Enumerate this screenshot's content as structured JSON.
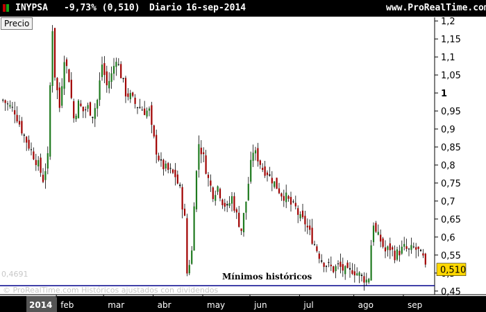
{
  "header": {
    "ticker": "INYPSA",
    "change": "-9,73% (0,510)",
    "period": "Diario",
    "date": "16-sep-2014",
    "site": "www.ProRealTime.com"
  },
  "colors": {
    "up": "#1f7a1f",
    "down": "#a00000",
    "neutral": "#000000",
    "support": "#00008b",
    "price_tag": "#ffd700",
    "year_bar": "#000000"
  },
  "chart_data": {
    "type": "candlestick",
    "legend_label": "Precio",
    "last_price_label": "0,510",
    "support_level": 0.465,
    "support_label_ghost": "0,4691",
    "annotation": "Mínimos históricos",
    "watermark": "© ProRealTime.com  Históricos ajustados con dividendos",
    "ylim": [
      0.44,
      1.21
    ],
    "y_ticks": [
      {
        "v": 1.2,
        "label": "1,2"
      },
      {
        "v": 1.15,
        "label": "1,15"
      },
      {
        "v": 1.1,
        "label": "1,1"
      },
      {
        "v": 1.05,
        "label": "1,05"
      },
      {
        "v": 1.0,
        "label": "1"
      },
      {
        "v": 0.95,
        "label": "0,95"
      },
      {
        "v": 0.9,
        "label": "0,9"
      },
      {
        "v": 0.85,
        "label": "0,85"
      },
      {
        "v": 0.8,
        "label": "0,8"
      },
      {
        "v": 0.75,
        "label": "0,75"
      },
      {
        "v": 0.7,
        "label": "0,7"
      },
      {
        "v": 0.65,
        "label": "0,65"
      },
      {
        "v": 0.6,
        "label": "0,6"
      },
      {
        "v": 0.55,
        "label": "0,55"
      },
      {
        "v": 0.5,
        "label": "0,5"
      },
      {
        "v": 0.45,
        "label": "0,45"
      }
    ],
    "x_ticks": [
      {
        "label": "2014",
        "i": 0
      },
      {
        "label": "feb",
        "i": 23
      },
      {
        "label": "mar",
        "i": 43
      },
      {
        "label": "abr",
        "i": 64
      },
      {
        "label": "may",
        "i": 85
      },
      {
        "label": "jun",
        "i": 105
      },
      {
        "label": "jul",
        "i": 126
      },
      {
        "label": "ago",
        "i": 149
      },
      {
        "label": "sep",
        "i": 170
      }
    ],
    "close_path": [
      [
        0,
        0.98
      ],
      [
        5,
        0.95
      ],
      [
        9,
        0.88
      ],
      [
        12,
        0.84
      ],
      [
        15,
        0.8
      ],
      [
        17,
        0.76
      ],
      [
        19,
        0.82
      ],
      [
        20,
        1.02
      ],
      [
        21,
        1.18
      ],
      [
        22,
        1.05
      ],
      [
        24,
        0.96
      ],
      [
        26,
        1.1
      ],
      [
        28,
        1.04
      ],
      [
        30,
        0.93
      ],
      [
        32,
        0.97
      ],
      [
        34,
        0.95
      ],
      [
        36,
        0.96
      ],
      [
        38,
        0.94
      ],
      [
        40,
        0.98
      ],
      [
        42,
        1.08
      ],
      [
        44,
        1.02
      ],
      [
        46,
        1.05
      ],
      [
        48,
        1.1
      ],
      [
        50,
        1.05
      ],
      [
        52,
        1.0
      ],
      [
        54,
        0.99
      ],
      [
        56,
        0.97
      ],
      [
        58,
        0.96
      ],
      [
        60,
        0.95
      ],
      [
        62,
        0.95
      ],
      [
        63,
        0.9
      ],
      [
        65,
        0.84
      ],
      [
        67,
        0.8
      ],
      [
        69,
        0.79
      ],
      [
        71,
        0.78
      ],
      [
        73,
        0.77
      ],
      [
        75,
        0.73
      ],
      [
        77,
        0.65
      ],
      [
        78,
        0.5
      ],
      [
        80,
        0.56
      ],
      [
        81,
        0.7
      ],
      [
        83,
        0.86
      ],
      [
        85,
        0.82
      ],
      [
        87,
        0.76
      ],
      [
        89,
        0.72
      ],
      [
        91,
        0.74
      ],
      [
        93,
        0.7
      ],
      [
        95,
        0.68
      ],
      [
        97,
        0.71
      ],
      [
        99,
        0.66
      ],
      [
        101,
        0.62
      ],
      [
        102,
        0.66
      ],
      [
        103,
        0.7
      ],
      [
        105,
        0.8
      ],
      [
        106,
        0.84
      ],
      [
        108,
        0.82
      ],
      [
        110,
        0.79
      ],
      [
        112,
        0.78
      ],
      [
        114,
        0.76
      ],
      [
        116,
        0.74
      ],
      [
        118,
        0.72
      ],
      [
        120,
        0.71
      ],
      [
        122,
        0.69
      ],
      [
        124,
        0.68
      ],
      [
        126,
        0.65
      ],
      [
        128,
        0.64
      ],
      [
        130,
        0.61
      ],
      [
        132,
        0.58
      ],
      [
        134,
        0.55
      ],
      [
        136,
        0.53
      ],
      [
        138,
        0.52
      ],
      [
        140,
        0.51
      ],
      [
        142,
        0.52
      ],
      [
        144,
        0.51
      ],
      [
        146,
        0.5
      ],
      [
        148,
        0.51
      ],
      [
        150,
        0.5
      ],
      [
        152,
        0.49
      ],
      [
        154,
        0.48
      ],
      [
        155,
        0.49
      ],
      [
        156,
        0.58
      ],
      [
        157,
        0.64
      ],
      [
        158,
        0.61
      ],
      [
        160,
        0.59
      ],
      [
        162,
        0.56
      ],
      [
        164,
        0.57
      ],
      [
        166,
        0.55
      ],
      [
        168,
        0.56
      ],
      [
        170,
        0.57
      ],
      [
        172,
        0.56
      ],
      [
        174,
        0.57
      ],
      [
        176,
        0.56
      ],
      [
        178,
        0.54
      ],
      [
        179,
        0.51
      ]
    ]
  }
}
